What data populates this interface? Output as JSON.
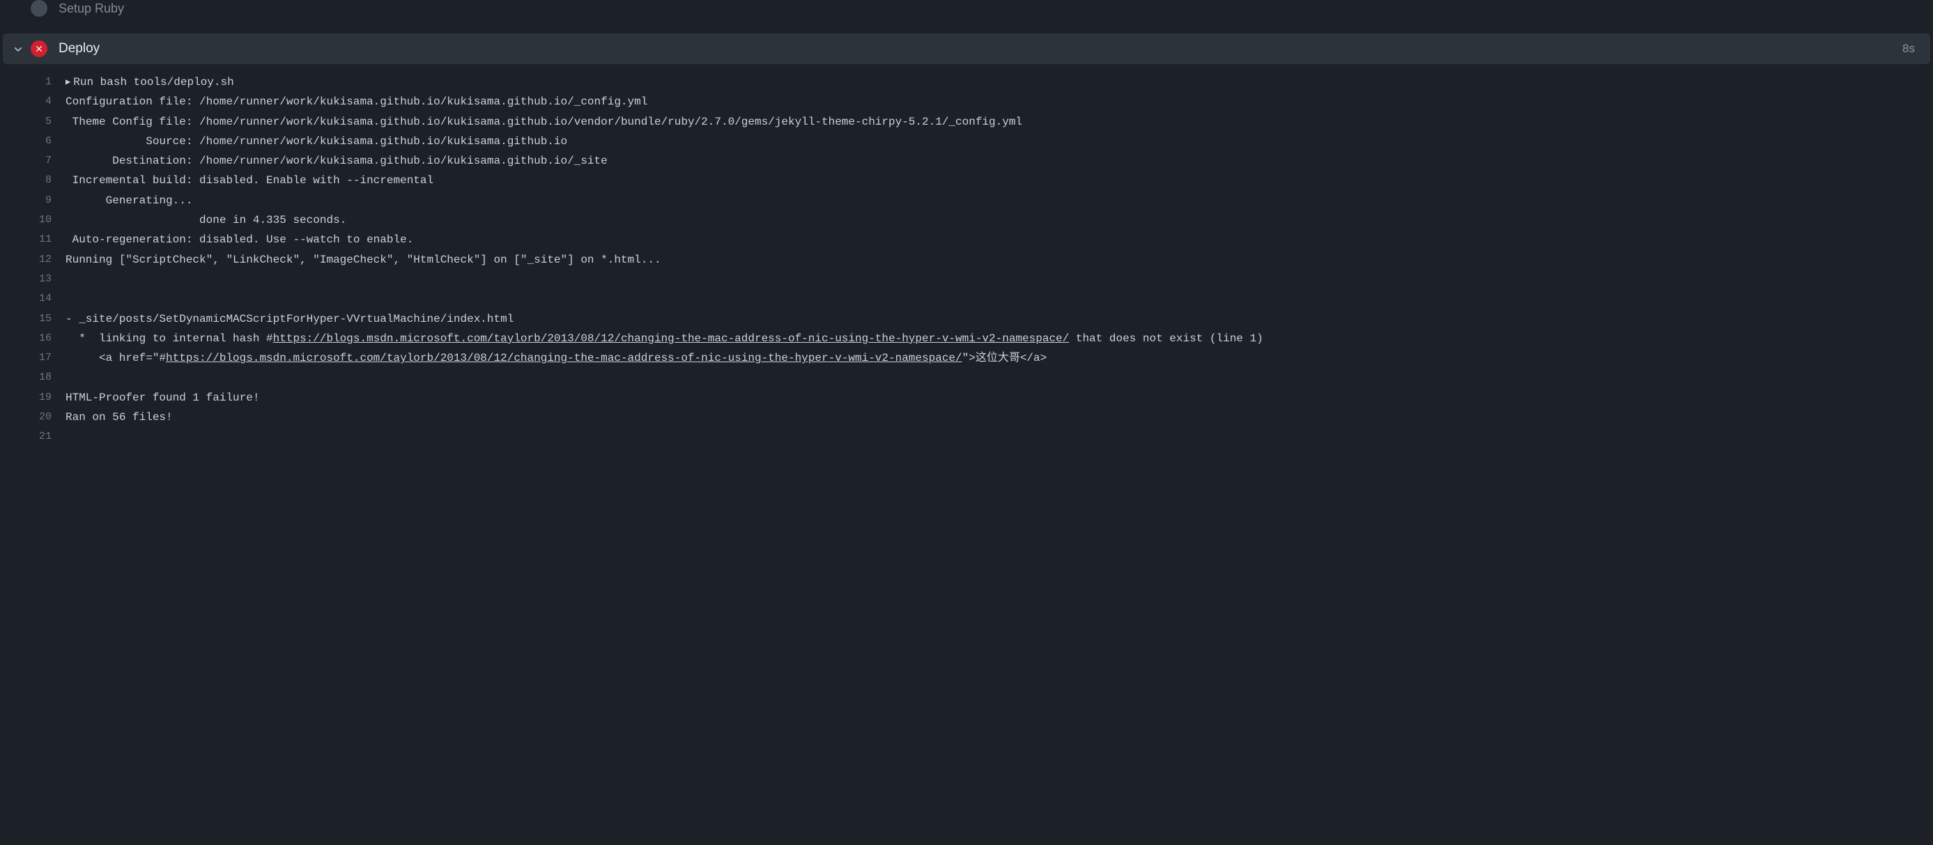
{
  "previous_step": {
    "label": "Setup Ruby"
  },
  "step": {
    "title": "Deploy",
    "duration": "8s"
  },
  "log": {
    "l1": {
      "num": "1",
      "tri": "▶",
      "text": "Run bash tools/deploy.sh"
    },
    "l4": {
      "num": "4",
      "text": "Configuration file: /home/runner/work/kukisama.github.io/kukisama.github.io/_config.yml"
    },
    "l5": {
      "num": "5",
      "text": " Theme Config file: /home/runner/work/kukisama.github.io/kukisama.github.io/vendor/bundle/ruby/2.7.0/gems/jekyll-theme-chirpy-5.2.1/_config.yml"
    },
    "l6": {
      "num": "6",
      "text": "            Source: /home/runner/work/kukisama.github.io/kukisama.github.io"
    },
    "l7": {
      "num": "7",
      "text": "       Destination: /home/runner/work/kukisama.github.io/kukisama.github.io/_site"
    },
    "l8": {
      "num": "8",
      "text": " Incremental build: disabled. Enable with --incremental"
    },
    "l9": {
      "num": "9",
      "text": "      Generating..."
    },
    "l10": {
      "num": "10",
      "text": "                    done in 4.335 seconds."
    },
    "l11": {
      "num": "11",
      "text": " Auto-regeneration: disabled. Use --watch to enable."
    },
    "l12": {
      "num": "12",
      "text": "Running [\"ScriptCheck\", \"LinkCheck\", \"ImageCheck\", \"HtmlCheck\"] on [\"_site\"] on *.html..."
    },
    "l13": {
      "num": "13",
      "text": ""
    },
    "l14": {
      "num": "14",
      "text": ""
    },
    "l15": {
      "num": "15",
      "text": "- _site/posts/SetDynamicMACScriptForHyper-VVrtualMachine/index.html"
    },
    "l16": {
      "num": "16",
      "pre": "  *  linking to internal hash #",
      "link": "https://blogs.msdn.microsoft.com/taylorb/2013/08/12/changing-the-mac-address-of-nic-using-the-hyper-v-wmi-v2-namespace/",
      "post": " that does not exist (line 1)"
    },
    "l17": {
      "num": "17",
      "pre": "     <a href=\"#",
      "link": "https://blogs.msdn.microsoft.com/taylorb/2013/08/12/changing-the-mac-address-of-nic-using-the-hyper-v-wmi-v2-namespace/",
      "post": "\">这位大哥</a>"
    },
    "l18": {
      "num": "18",
      "text": ""
    },
    "l19": {
      "num": "19",
      "text": "HTML-Proofer found 1 failure!"
    },
    "l20": {
      "num": "20",
      "text": "Ran on 56 files!"
    },
    "l21": {
      "num": "21",
      "text": ""
    }
  }
}
